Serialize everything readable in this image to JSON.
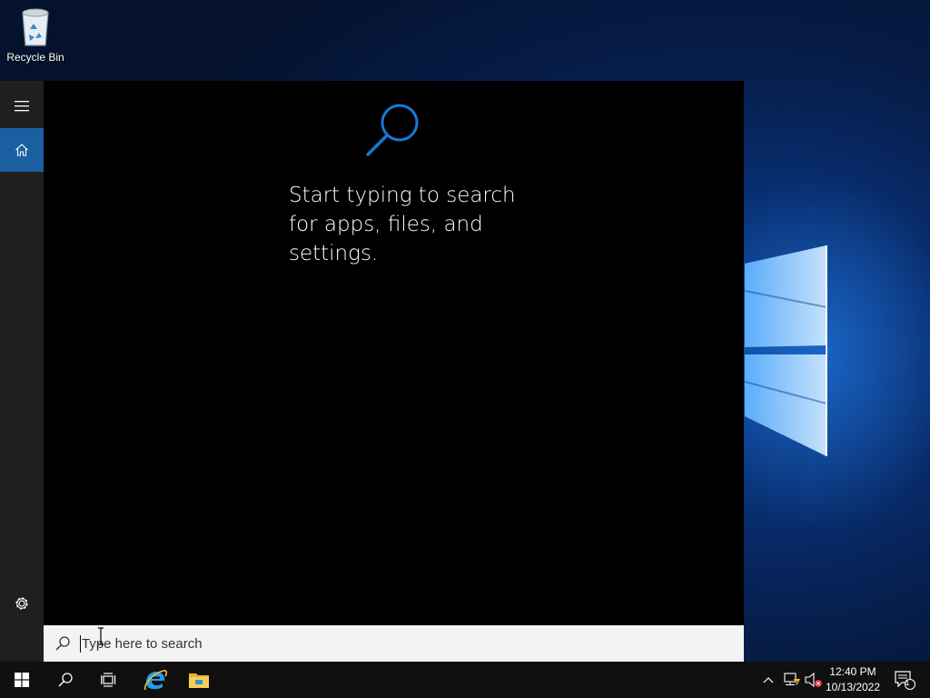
{
  "desktop": {
    "icons": [
      {
        "label": "Recycle Bin",
        "icon": "recycle-bin-icon"
      }
    ]
  },
  "start_menu": {
    "rail": {
      "menu_icon": "hamburger-icon",
      "home_icon": "home-icon",
      "settings_icon": "gear-icon"
    },
    "search_pane": {
      "hint_lines": [
        "Start typing to search",
        "for apps, files, and",
        "settings."
      ],
      "accent_color": "#1a78d4"
    }
  },
  "search_box": {
    "placeholder": "Type here to search",
    "value": ""
  },
  "taskbar": {
    "start_icon": "windows-logo-icon",
    "search_icon": "search-icon",
    "task_view_icon": "task-view-icon",
    "pinned": [
      {
        "name": "internet-explorer-icon"
      },
      {
        "name": "file-explorer-icon"
      }
    ],
    "tray": {
      "chevron_icon": "chevron-up-icon",
      "network_icon": "network-icon",
      "volume_icon": "volume-muted-icon",
      "time": "12:40 PM",
      "date": "10/13/2022",
      "notifications_count": "1"
    }
  }
}
